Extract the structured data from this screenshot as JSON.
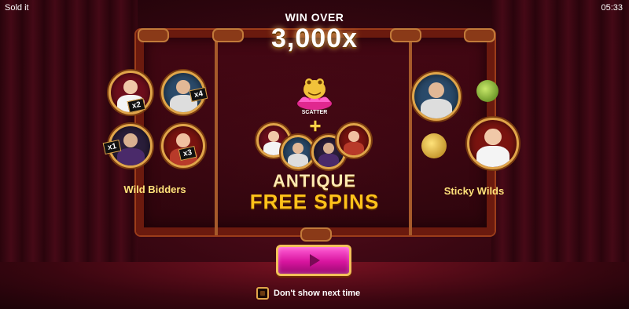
{
  "app": {
    "title": "Sold it",
    "clock": "05:33"
  },
  "header": {
    "win_over": "WIN OVER",
    "win_amount": "3,000x"
  },
  "left_feature": {
    "label": "Wild Bidders",
    "multipliers": [
      "x2",
      "x4",
      "x1",
      "x3"
    ]
  },
  "center_feature": {
    "scatter_label": "SCATTER",
    "plus": "+",
    "line1": "ANTIQUE",
    "line2": "FREE SPINS"
  },
  "right_feature": {
    "label": "Sticky Wilds"
  },
  "controls": {
    "dont_show_label": "Don't show next time",
    "dont_show_checked": false
  },
  "colors": {
    "accent_gold": "#ffc21a",
    "button_pink": "#d8149e",
    "frame_wood": "#6b1a0e"
  }
}
